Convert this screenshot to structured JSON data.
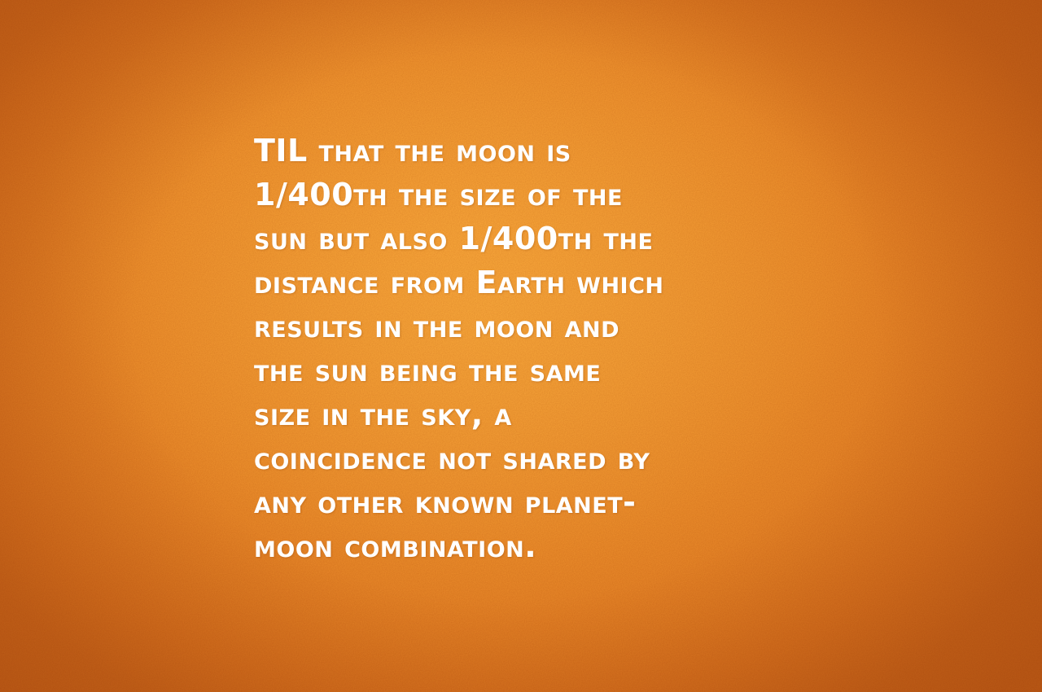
{
  "fact": {
    "lines": [
      "TIL that the moon is",
      "1/400th the size of the",
      "sun but also 1/400th the",
      "distance from Earth which",
      "results in the moon and",
      "the sun being the same",
      "size in the sky, a",
      "coincidence not shared by",
      "any other known planet-",
      "moon combination."
    ]
  },
  "colors": {
    "text": "#ffffff",
    "background": "#e98b2a"
  }
}
